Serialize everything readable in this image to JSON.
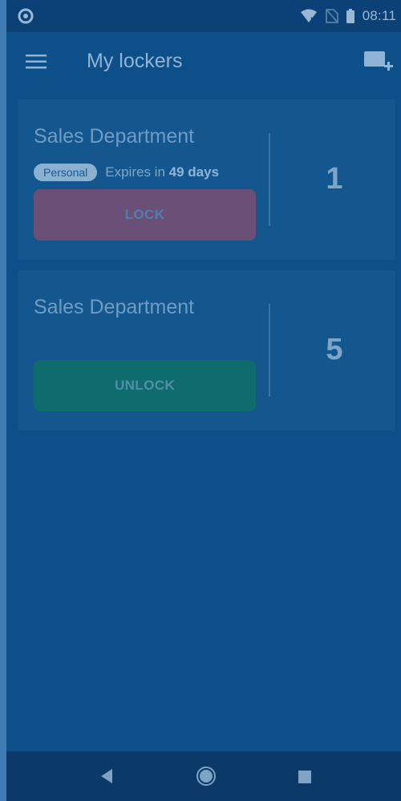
{
  "status_bar": {
    "time": "08:11",
    "icons": [
      "app-logo-icon",
      "wifi-off-icon",
      "no-sim-icon",
      "battery-icon"
    ]
  },
  "app_bar": {
    "title": "My lockers",
    "menu_icon": "menu-icon",
    "add_icon": "add-locker-icon"
  },
  "lockers": [
    {
      "name": "Sales Department",
      "badge": "Personal",
      "expires_prefix": "Expires in",
      "expires_value": "49 days",
      "action_label": "LOCK",
      "number": "1"
    },
    {
      "name": "Sales Department",
      "action_label": "UNLOCK",
      "number": "5"
    }
  ],
  "nav_bar": {
    "icons": [
      "back-icon",
      "home-icon",
      "recents-icon"
    ]
  },
  "colors": {
    "background": "#0d4f88",
    "card": "#14578f",
    "lock_button": "#6a5076",
    "unlock_button": "#0e6c6c"
  }
}
